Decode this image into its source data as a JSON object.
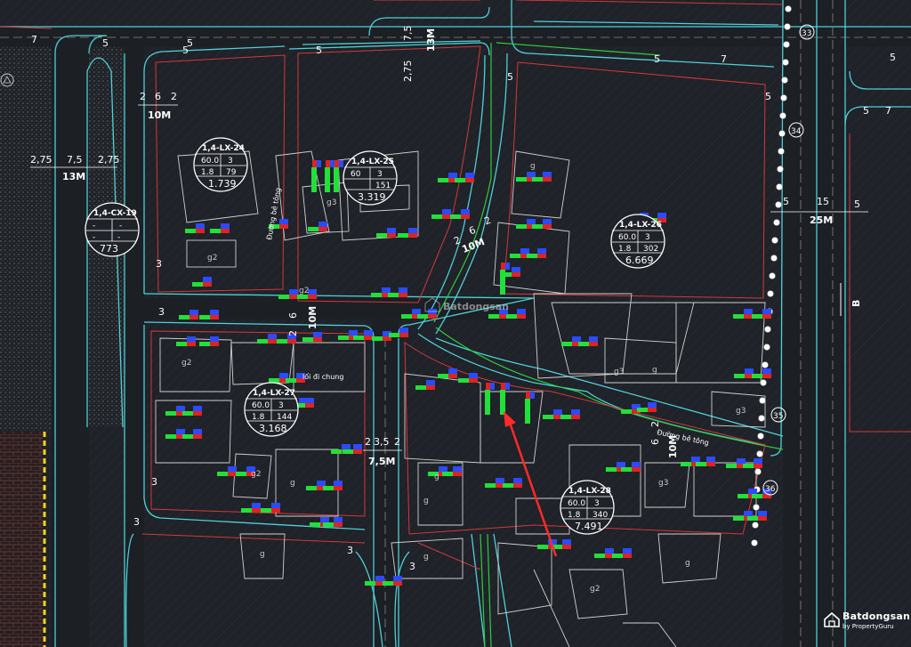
{
  "roads": {
    "dims_13m_left": [
      "2,75",
      "7,5",
      "2,75"
    ],
    "label_13m_left": "13M",
    "dims_10m_top": [
      "2",
      "6",
      "2"
    ],
    "label_10m_top": "10M",
    "dims_13m_top": [
      "2,75",
      "7,5"
    ],
    "label_13m_top": "13M",
    "dims_25m": [
      "5",
      "15",
      "5"
    ],
    "label_25m": "25M",
    "label_b": "B",
    "dims_10m_mid": [
      "2",
      "6"
    ],
    "label_10m_mid": "10M",
    "dims_10m_diag": [
      "2",
      "6",
      "2"
    ],
    "label_10m_diag": "10M",
    "dims_75m": [
      "2",
      "3,5",
      "2"
    ],
    "label_75m": "7,5M",
    "dims_10m_right": [
      "2",
      "6"
    ],
    "label_10m_right": "10M",
    "corner_radii": [
      "7",
      "5",
      "5",
      "5",
      "5",
      "5",
      "5",
      "7",
      "5",
      "7",
      "5",
      "3",
      "3",
      "3",
      "3",
      "3",
      "3",
      "5"
    ],
    "road_names": [
      "Đường bê tông",
      "lối đi chung",
      "Đường bê tông"
    ]
  },
  "lots": [
    {
      "code": "1,4-LX-24",
      "cells": [
        "60.0",
        "3",
        "1.8",
        "79"
      ],
      "area": "1.739"
    },
    {
      "code": "1,4-LX-25",
      "cells": [
        "60",
        "3",
        "",
        "151"
      ],
      "area": "3.319"
    },
    {
      "code": "1,4-CX-19",
      "cells": [
        "-",
        "-",
        "-",
        "-"
      ],
      "area": "773"
    },
    {
      "code": "1,4-LX-26",
      "cells": [
        "60.0",
        "3",
        "1.8",
        "302"
      ],
      "area": "6.669"
    },
    {
      "code": "1,4-LX-27",
      "cells": [
        "60.0",
        "3",
        "1.8",
        "144"
      ],
      "area": "3.168"
    },
    {
      "code": "1,4-LX-28",
      "cells": [
        "60.0",
        "3",
        "1.8",
        "340"
      ],
      "area": "7.491"
    }
  ],
  "building_labels": [
    "g",
    "g2",
    "g3"
  ],
  "markers": [
    "33",
    "34",
    "35",
    "36"
  ],
  "colors": {
    "background": "#1f2228",
    "road_edge": "#4fd0d8",
    "lot_boundary": "#d23a3a",
    "plot_line": "#d8d8d8",
    "green_line": "#2ecc40",
    "arrow": "#ff2a2a",
    "hatch": "#2c3038"
  },
  "watermark": {
    "brand": "Batdongsan",
    "sub": "by PropertyGuru",
    "icon": "house-logo-icon"
  },
  "center_watermark": "Batdongsan"
}
